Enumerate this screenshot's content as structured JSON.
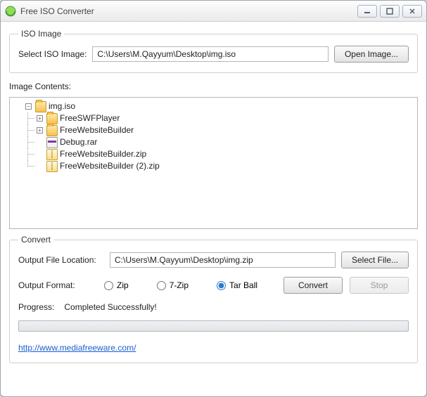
{
  "window": {
    "title": "Free ISO Converter"
  },
  "iso": {
    "legend": "ISO Image",
    "select_label": "Select ISO Image:",
    "path": "C:\\Users\\M.Qayyum\\Desktop\\img.iso",
    "open_btn": "Open Image..."
  },
  "contents": {
    "label": "Image Contents:",
    "root": "img.iso",
    "items": [
      {
        "name": "FreeSWFPlayer",
        "type": "folder",
        "expand": "+"
      },
      {
        "name": "FreeWebsiteBuilder",
        "type": "folder",
        "expand": "+"
      },
      {
        "name": "Debug.rar",
        "type": "rar"
      },
      {
        "name": "FreeWebsiteBuilder.zip",
        "type": "zip"
      },
      {
        "name": "FreeWebsiteBuilder (2).zip",
        "type": "zip"
      }
    ]
  },
  "convert": {
    "legend": "Convert",
    "output_label": "Output File Location:",
    "output_path": "C:\\Users\\M.Qayyum\\Desktop\\img.zip",
    "select_file_btn": "Select File...",
    "format_label": "Output Format:",
    "formats": {
      "zip": "Zip",
      "sevenzip": "7-Zip",
      "tarball": "Tar Ball"
    },
    "selected_format": "tarball",
    "convert_btn": "Convert",
    "stop_btn": "Stop",
    "progress_label": "Progress:",
    "progress_text": "Completed Successfully!",
    "link": "http://www.mediafreeware.com/"
  }
}
